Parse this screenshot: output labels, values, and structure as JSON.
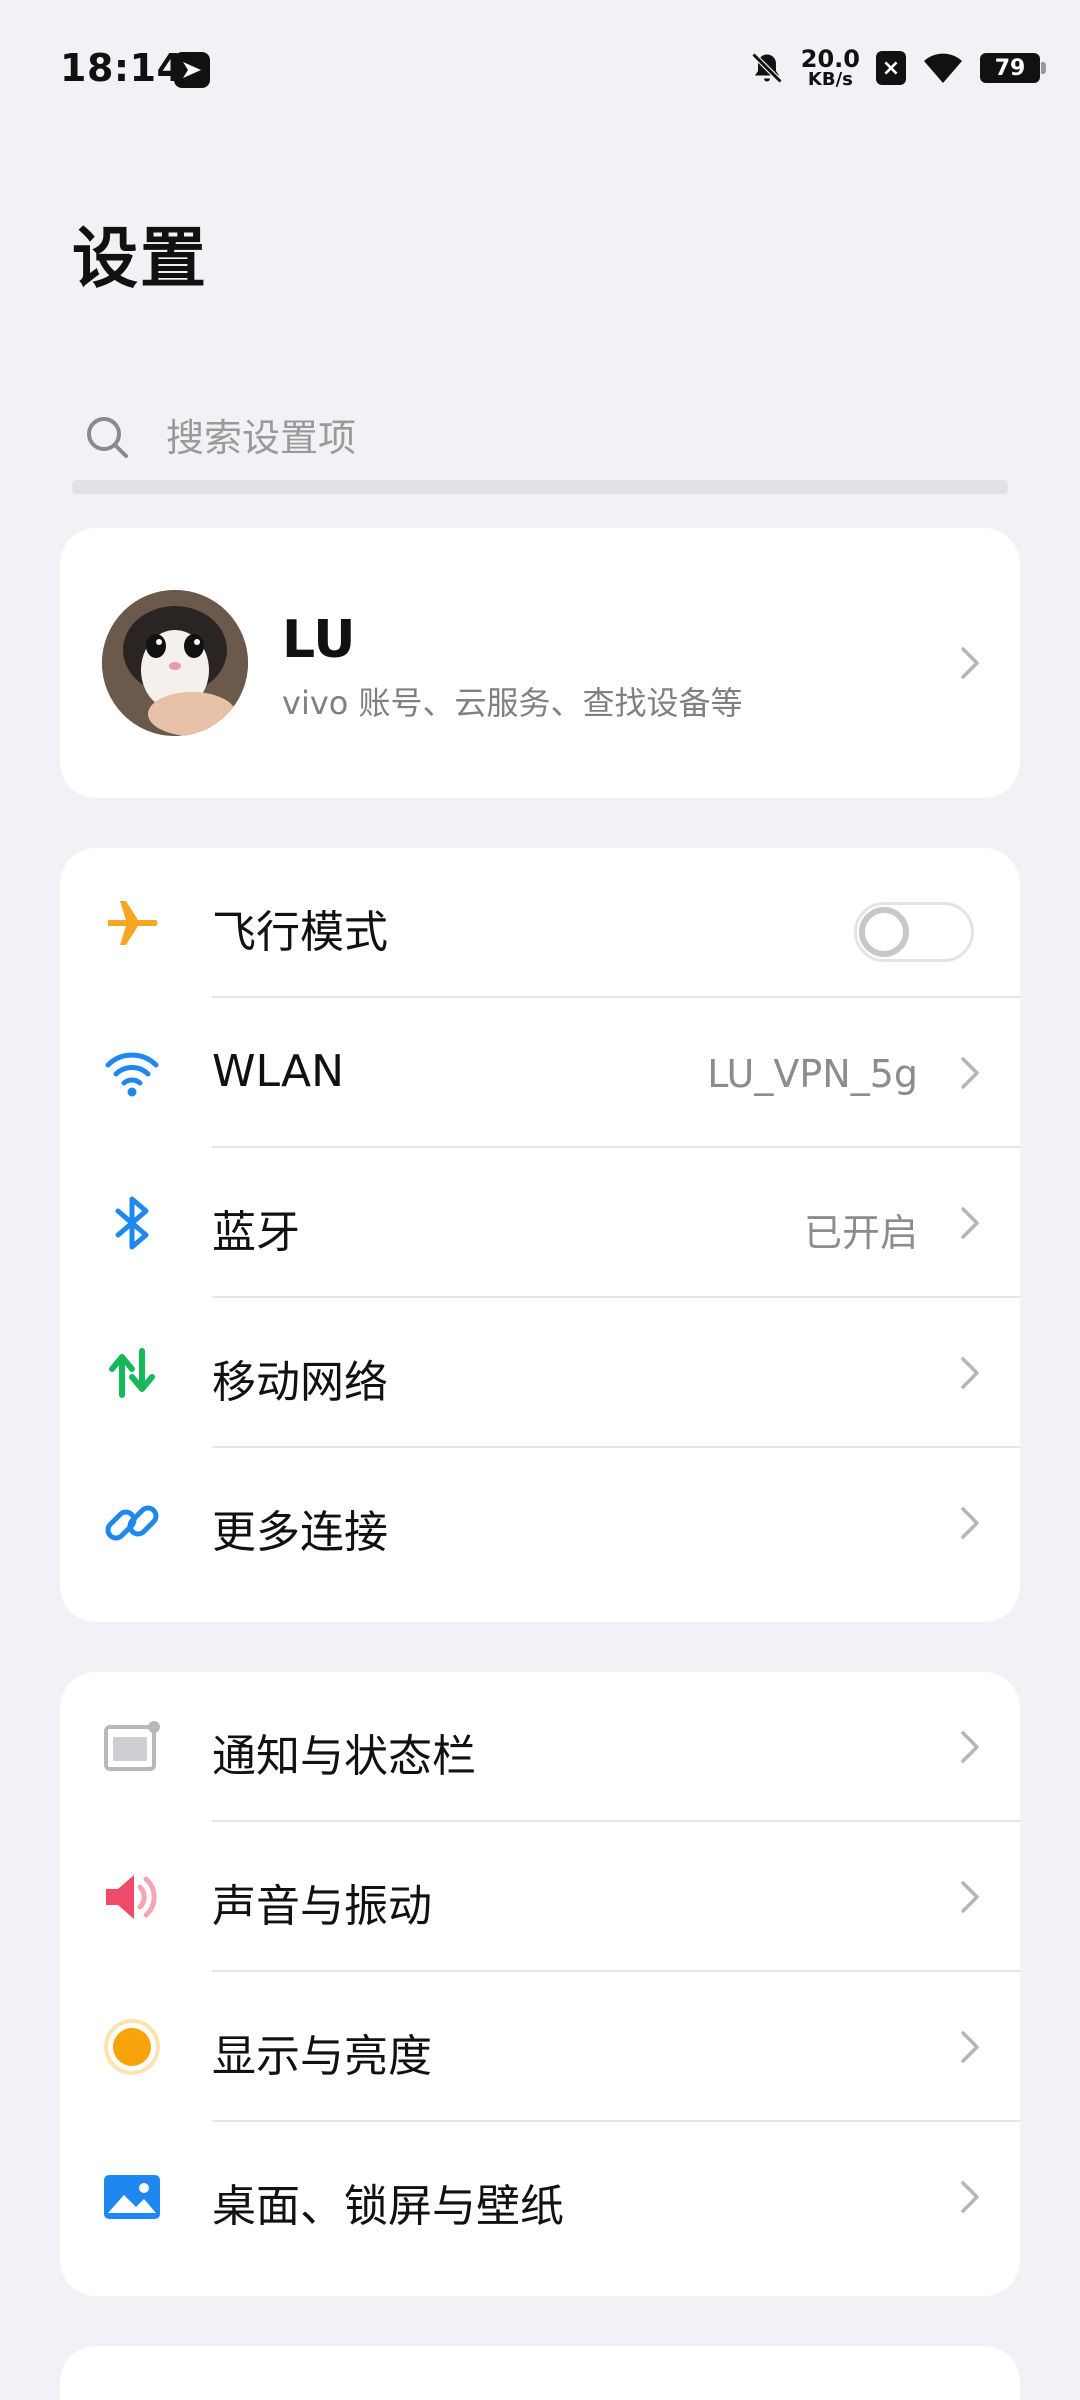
{
  "status_bar": {
    "time": "18:14",
    "net_speed_value": "20.0",
    "net_speed_unit": "KB/s",
    "sim_badge": "×",
    "battery": "79"
  },
  "page": {
    "title": "设置"
  },
  "search": {
    "placeholder": "搜索设置项"
  },
  "account": {
    "name": "LU",
    "subtitle": "vivo 账号、云服务、查找设备等"
  },
  "connectivity": {
    "airplane": {
      "label": "飞行模式",
      "enabled": false,
      "icon": "airplane-icon",
      "color": "#f5a623"
    },
    "wlan": {
      "label": "WLAN",
      "value": "LU_VPN_5g",
      "icon": "wifi-icon",
      "color": "#1e88f0"
    },
    "bluetooth": {
      "label": "蓝牙",
      "value": "已开启",
      "icon": "bluetooth-icon",
      "color": "#1e88f0"
    },
    "mobile": {
      "label": "移动网络",
      "icon": "mobile-data-icon",
      "color": "#16b85a"
    },
    "more": {
      "label": "更多连接",
      "icon": "link-icon",
      "color": "#1e88f0"
    }
  },
  "display": {
    "notifications": {
      "label": "通知与状态栏",
      "icon": "notification-bar-icon"
    },
    "sound": {
      "label": "声音与振动",
      "icon": "speaker-icon",
      "color": "#f04a6a"
    },
    "brightness": {
      "label": "显示与亮度",
      "icon": "brightness-icon",
      "color": "#f7a30a"
    },
    "wallpaper": {
      "label": "桌面、锁屏与壁纸",
      "icon": "wallpaper-icon",
      "color": "#1e88f0"
    }
  }
}
